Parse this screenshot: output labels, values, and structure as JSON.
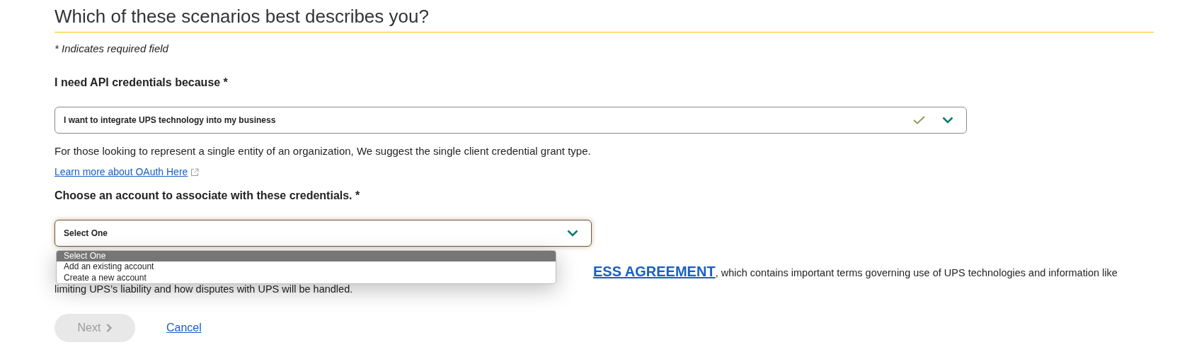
{
  "heading": "Which of these scenarios best describes you?",
  "required_note": "* Indicates required field",
  "reason_field": {
    "label": "I need API credentials because *",
    "value": "I want to integrate UPS technology into my business",
    "valid": true
  },
  "suggestion": "For those looking to represent a single entity of an organization, We suggest the single client credential grant type.",
  "oauth_link": "Learn more about OAuth Here",
  "account_field": {
    "label": "Choose an account to associate with these credentials. *",
    "value": "Select One",
    "expanded": true,
    "options": [
      {
        "label": "Select One",
        "selected": true
      },
      {
        "label": "Add an existing account",
        "selected": false
      },
      {
        "label": "Create a new account",
        "selected": false
      }
    ]
  },
  "agreement": {
    "link": "ESS AGREEMENT",
    "line_1_rest": ", which contains important terms governing use of UPS technologies and information like",
    "line_2": "limiting UPS’s liability and how disputes with UPS will be handled."
  },
  "buttons": [
    {
      "label": "Next",
      "kind": "primary",
      "disabled": true
    },
    {
      "label": "Cancel",
      "kind": "link",
      "disabled": false
    }
  ]
}
